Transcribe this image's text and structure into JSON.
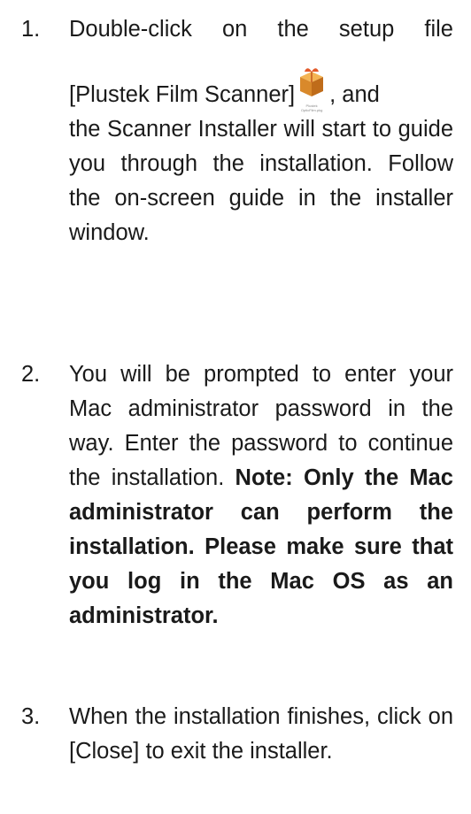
{
  "steps": [
    {
      "number": "1.",
      "text_line1": "Double-click on the setup file",
      "text_pre_icon": "[Plustek Film Scanner]",
      "icon": "package-installer-icon",
      "icon_label": "Plustek OpticFilm.pkg",
      "text_post_icon": ", and",
      "text_rest": "the Scanner Installer will start to guide you through the installation. Follow the on-screen guide in the installer window."
    },
    {
      "number": "2.",
      "text_normal": "You will be prompted to enter your Mac administrator password in the way. Enter the password to continue the installation. ",
      "text_bold": "Note: Only the Mac administrator can perform the installation. Please make sure that you log in the Mac OS as an administrator."
    },
    {
      "number": "3.",
      "text": "When the installation finishes, click on [Close] to exit the installer."
    }
  ],
  "colors": {
    "text": "#1a1a1a",
    "icon_box": "#d98a2b"
  }
}
